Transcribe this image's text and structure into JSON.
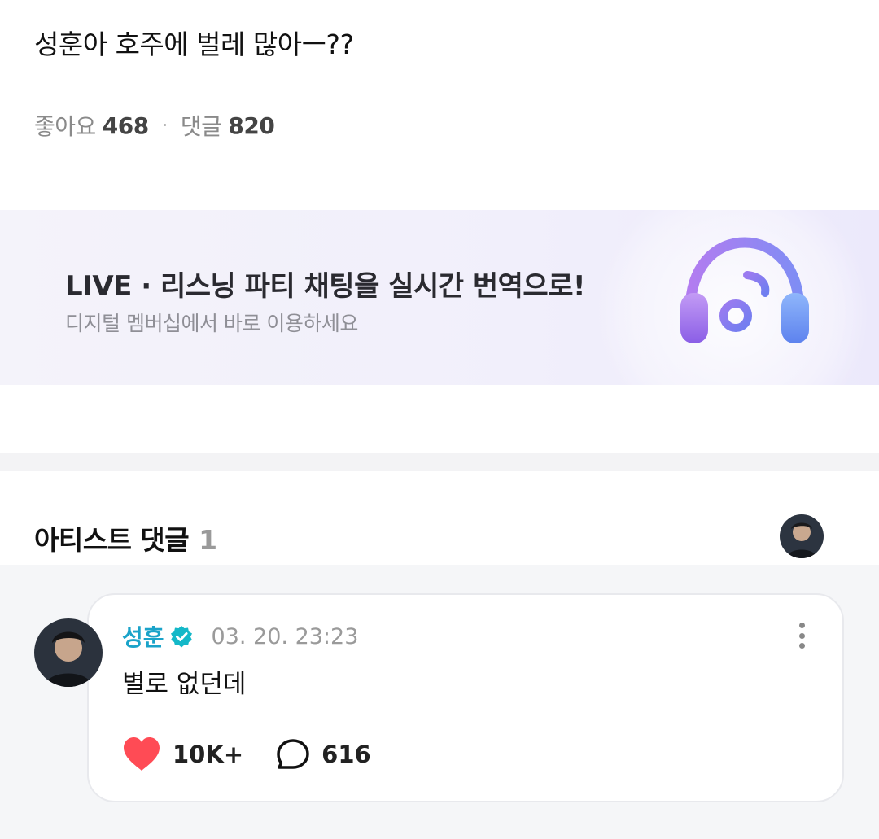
{
  "post": {
    "text": "성훈아 호주에 벌레 많아ㅡ??",
    "likes_label": "좋아요",
    "likes_count": "468",
    "separator": "·",
    "comments_label": "댓글",
    "comments_count": "820"
  },
  "banner": {
    "title": "LIVE · 리스닝 파티 채팅을 실시간 번역으로!",
    "subtitle": "디지털 멤버십에서 바로 이용하세요",
    "icon": "headphones-music-icon"
  },
  "artist_comments": {
    "title": "아티스트 댓글",
    "count": "1"
  },
  "comment": {
    "author": "성훈",
    "verified_icon": "verified-badge-icon",
    "time": "03. 20. 23:23",
    "text": "별로 없던데",
    "likes": "10K+",
    "replies": "616",
    "accent_color": "#1aa3c9",
    "heart_color": "#ff4b55"
  }
}
